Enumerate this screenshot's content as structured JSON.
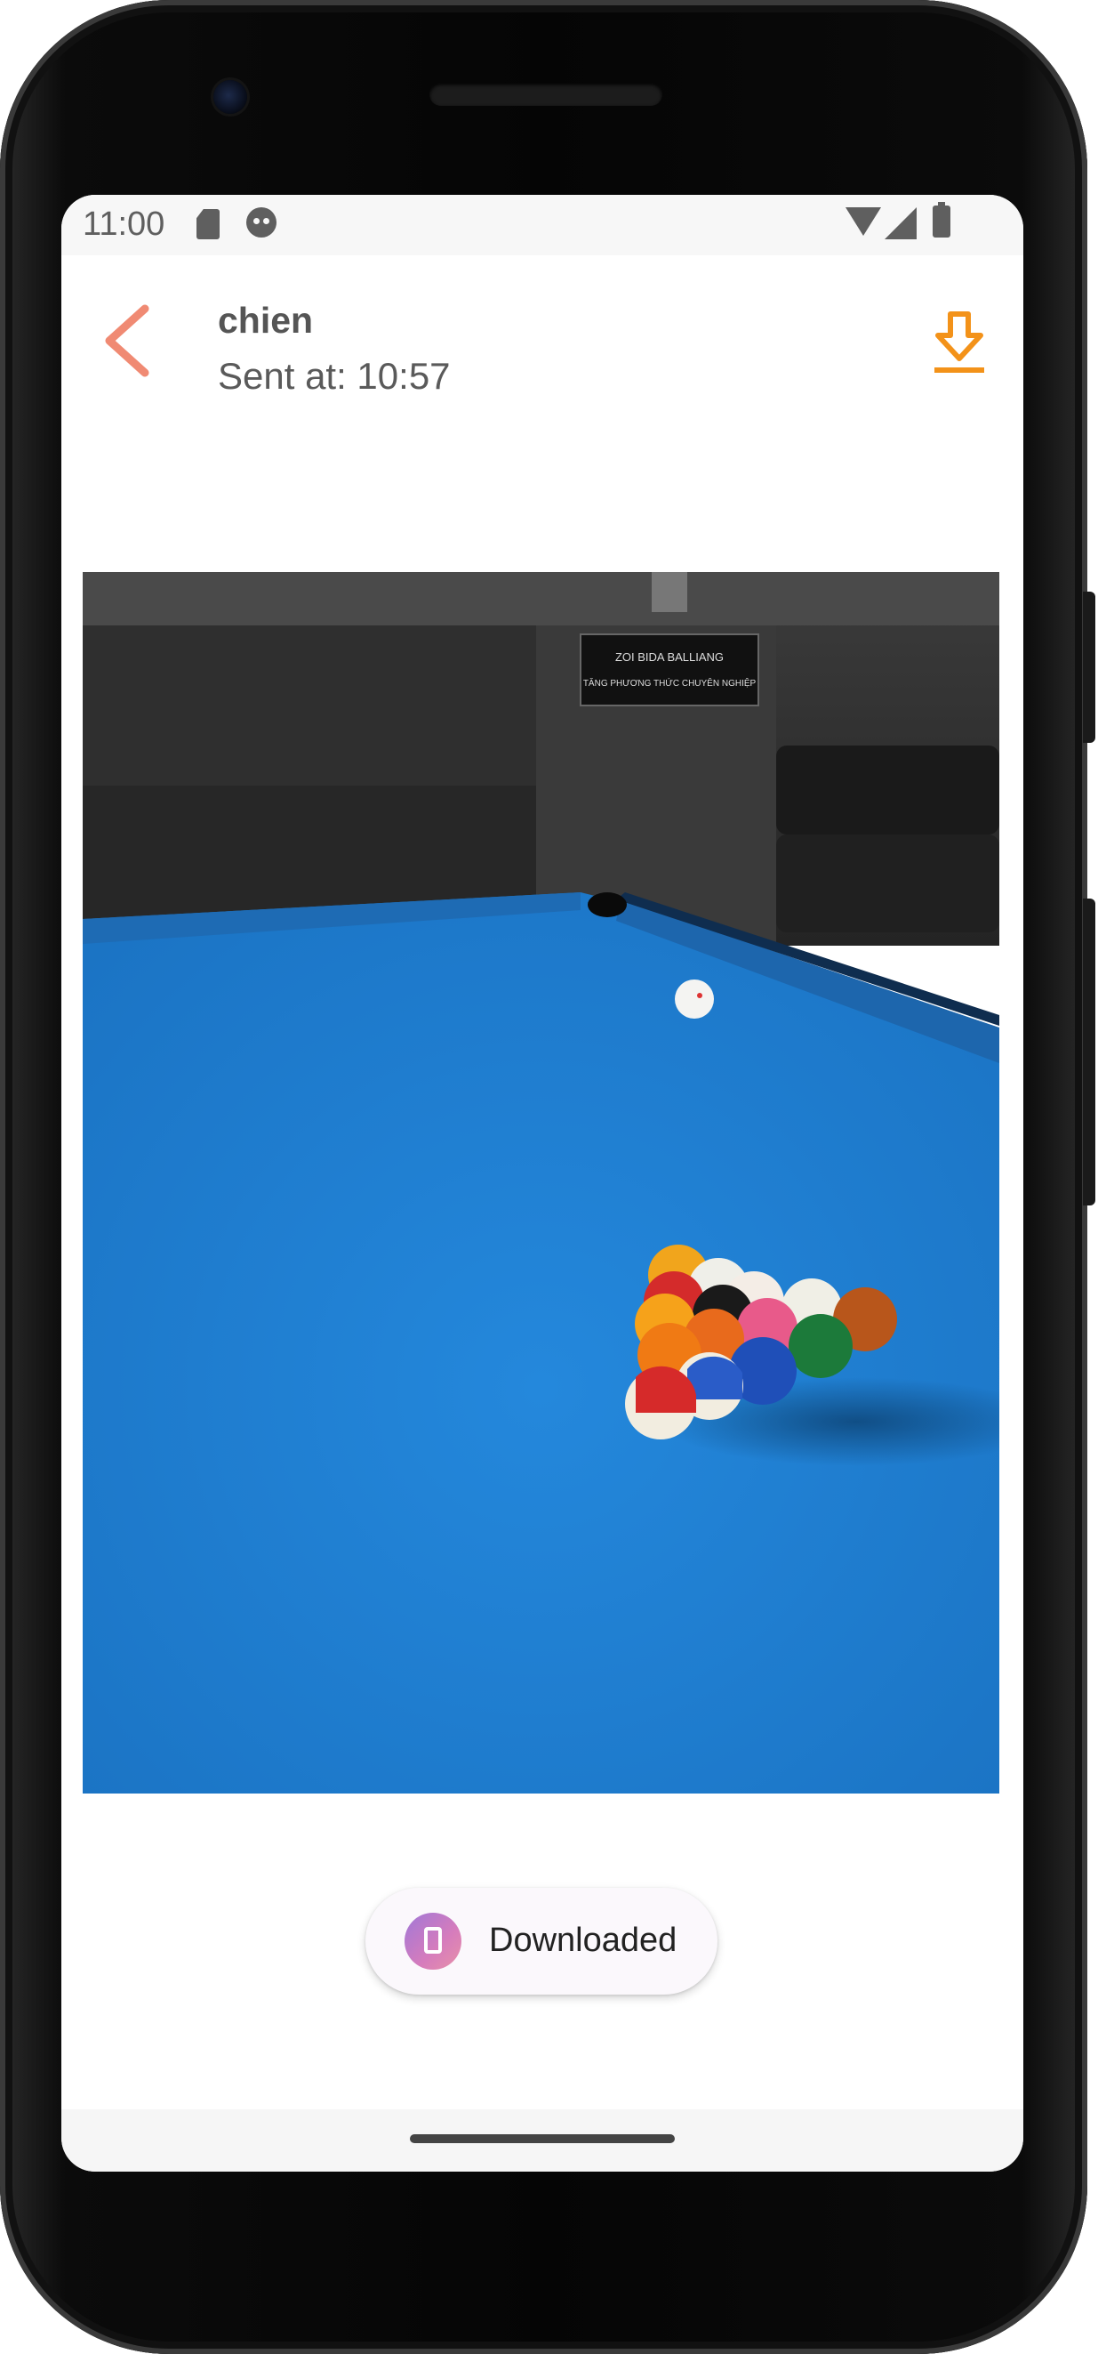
{
  "status_bar": {
    "time": "11:00",
    "icons": [
      "sd-card-icon",
      "face-notification-icon",
      "wifi-icon",
      "signal-icon",
      "battery-icon"
    ]
  },
  "header": {
    "sender": "chien",
    "sent_at": "Sent at: 10:57",
    "back_icon": "chevron-left-icon",
    "download_icon": "download-icon",
    "back_color": "#f08a73",
    "download_color": "#f39219"
  },
  "photo": {
    "icon": "image-attachment",
    "table_color": "#1f7fd0",
    "wall_sign_line1": "ZOI BIDA BALLIANG",
    "wall_sign_line2": "TĂNG PHƯƠNG THỨC CHUYÊN NGHIỆP"
  },
  "toast": {
    "text": "Downloaded",
    "icon": "app-icon"
  },
  "navigation": {
    "home_indicator": "home-pill"
  }
}
